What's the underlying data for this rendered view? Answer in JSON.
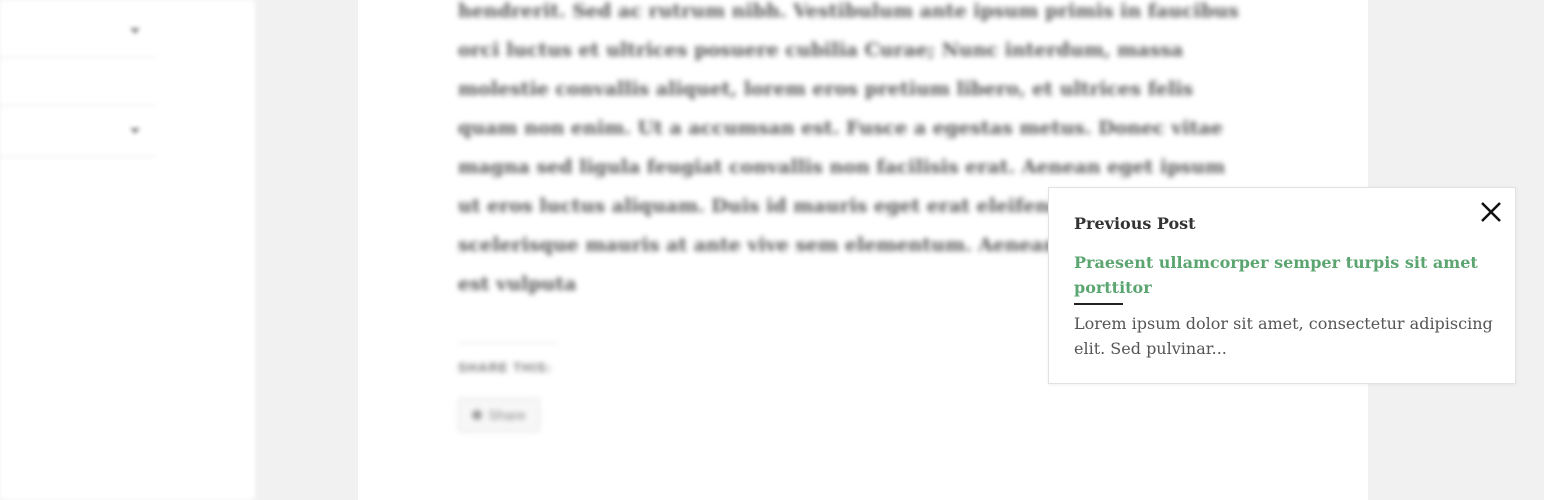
{
  "content": {
    "body_text": "hendrerit. Sed ac rutrum nibh. Vestibulum ante ipsum primis in faucibus orci luctus et ultrices posuere cubilia Curae; Nunc interdum, massa molestie convallis aliquet, lorem eros pretium libero, et ultrices felis quam non enim. Ut a accumsan est. Fusce a egestas metus. Donec vitae magna sed ligula feugiat convallis non facilisis erat. Aenean eget ipsum ut eros luctus aliquam. Duis id mauris eget erat eleifend ac magna. In scelerisque mauris at ante vive sem elementum. Aenean feugiat volutpat est vulputa",
    "share_label": "SHARE THIS:",
    "share_button_label": "Share"
  },
  "popup": {
    "heading": "Previous Post",
    "link_title": "Praesent ullamcorper semper turpis sit amet porttitor",
    "excerpt": "Lorem ipsum dolor sit amet, consectetur adipiscing elit. Sed pulvinar...",
    "close_icon": "close-icon",
    "link_color": "#5ba570"
  }
}
